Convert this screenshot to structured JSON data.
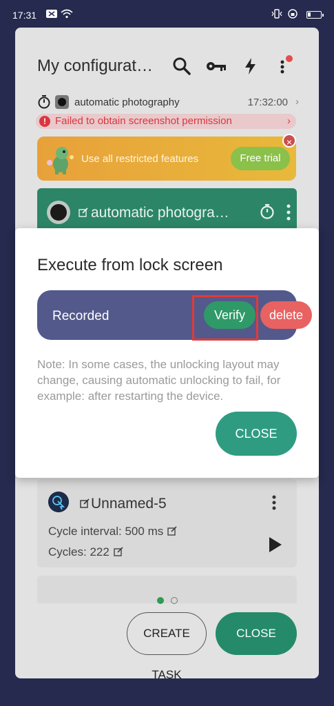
{
  "status_bar": {
    "time": "17:31"
  },
  "app": {
    "title": "My configurat…",
    "toolbar": [
      "search-icon",
      "key-icon",
      "bolt-icon",
      "more-icon"
    ]
  },
  "schedule_row": {
    "name": "automatic photography",
    "time": "17:32:00"
  },
  "error": {
    "text": "Failed to obtain screenshot permission"
  },
  "promo": {
    "text": "Use all restricted features",
    "button": "Free trial"
  },
  "task_card": {
    "name": "automatic photogra…"
  },
  "card2": {
    "name": "Unnamed-5",
    "cycle_interval": "Cycle interval: 500 ms",
    "cycles": "Cycles: 222"
  },
  "bottom": {
    "create_label": "CREATE TASK",
    "close_label": "CLOSE"
  },
  "dialog": {
    "title": "Execute from lock screen",
    "recorded_label": "Recorded",
    "verify_label": "Verify",
    "delete_label": "delete",
    "note": "Note: In some cases, the unlocking layout may change, causing automatic unlocking to fail, for example: after restarting the device.",
    "close_label": "CLOSE"
  },
  "colors": {
    "accent_green": "#2f9c82",
    "bar_purple": "#53598b",
    "danger": "#e86262"
  }
}
